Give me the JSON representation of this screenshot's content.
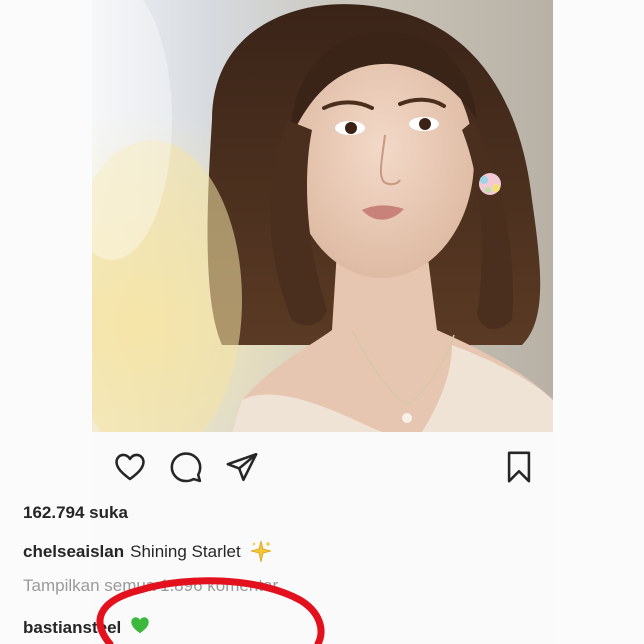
{
  "post": {
    "likes_text": "162.794 suka",
    "caption": {
      "username": "chelseaislan",
      "text": "Shining Starlet",
      "emoji": "sparkle-star"
    },
    "view_comments_text": "Tampilkan semua 1.896 komentar",
    "comment": {
      "username": "bastiansteel",
      "emoji": "green-heart"
    }
  },
  "icons": {
    "like": "heart-icon",
    "comment": "comment-bubble-icon",
    "share": "paper-plane-icon",
    "save": "bookmark-icon"
  },
  "colors": {
    "text": "#262626",
    "muted": "#9a9a9a",
    "annotation": "#e3101e",
    "green_heart": "#3cb93c"
  }
}
